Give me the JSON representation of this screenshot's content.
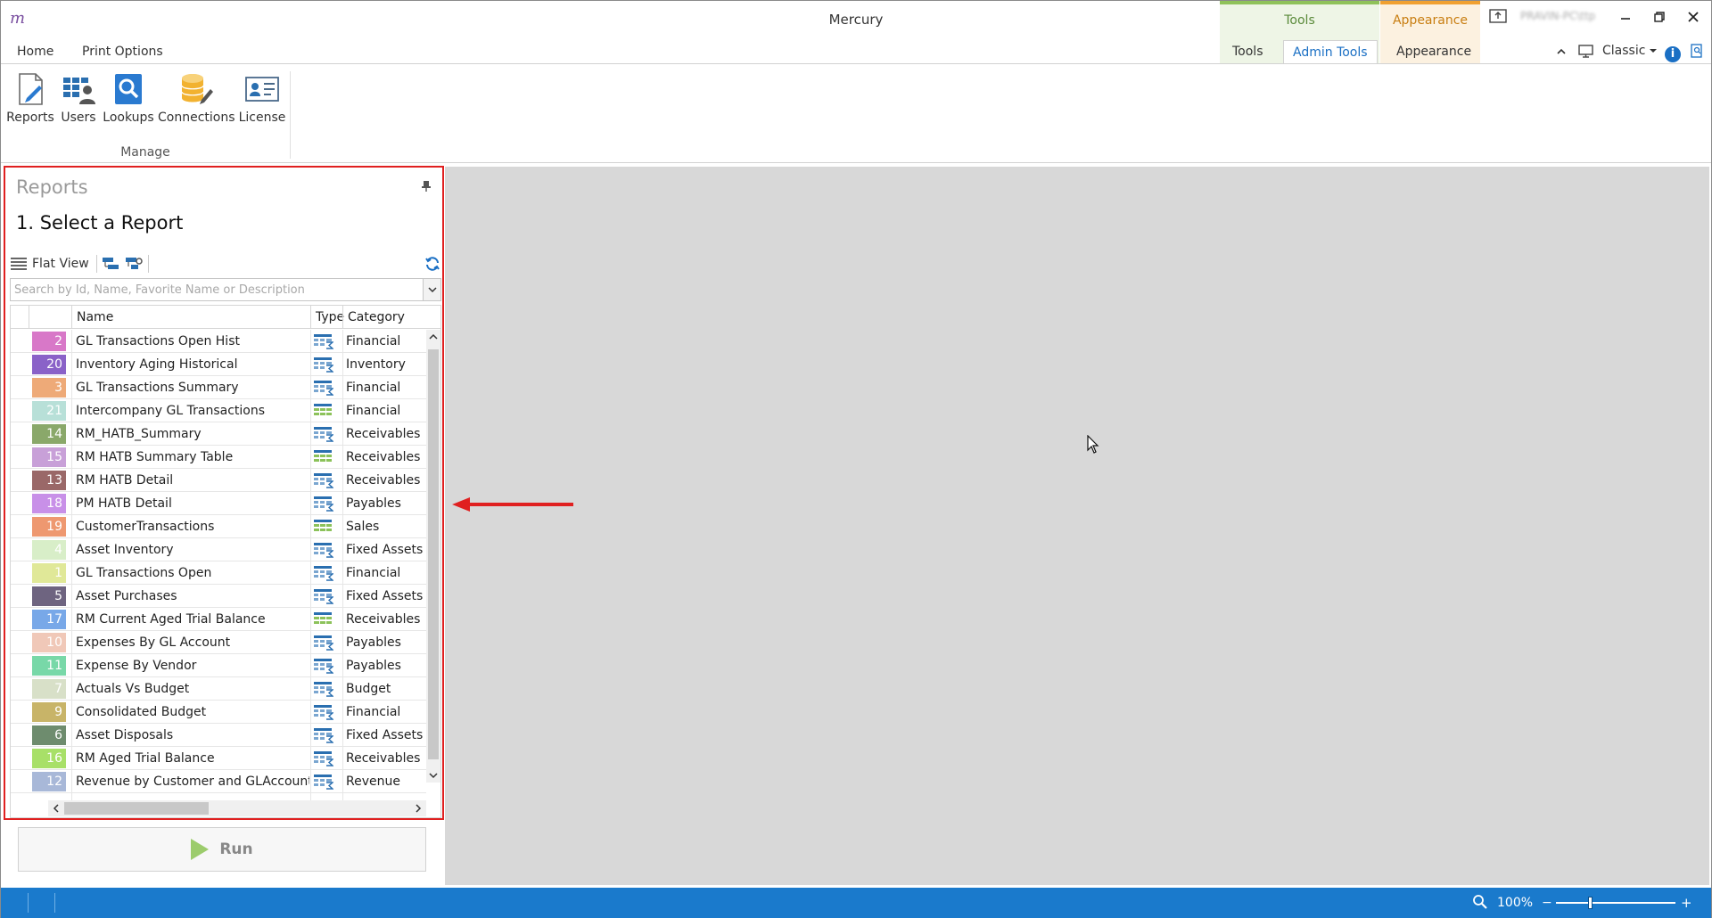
{
  "window": {
    "title": "Mercury",
    "blurred_user": "PRAVIN-PC\\ttp"
  },
  "context_groups": {
    "tools": "Tools",
    "appearance": "Appearance"
  },
  "ribbon": {
    "tabs": {
      "home": "Home",
      "print_options": "Print Options",
      "tools": "Tools",
      "admin_tools": "Admin Tools",
      "appearance": "Appearance"
    },
    "theme": "Classic",
    "buttons": {
      "reports": "Reports",
      "users": "Users",
      "lookups": "Lookups",
      "connections": "Connections",
      "license": "License"
    },
    "group": "Manage"
  },
  "panel": {
    "title": "Reports",
    "heading": "1. Select a Report",
    "flat_view": "Flat View",
    "search_placeholder": "Search by Id, Name, Favorite Name or Description",
    "columns": {
      "name": "Name",
      "type": "Type",
      "category": "Category"
    },
    "rows": [
      {
        "id": "2",
        "name": "GL Transactions Open Hist",
        "category": "Financial",
        "color": "#d878c8",
        "type_icon": "table-sum-icon"
      },
      {
        "id": "20",
        "name": "Inventory Aging Historical",
        "category": "Inventory",
        "color": "#8a62c8",
        "type_icon": "table-sum-icon"
      },
      {
        "id": "3",
        "name": "GL Transactions Summary",
        "category": "Financial",
        "color": "#eeaa78",
        "type_icon": "table-sum-icon"
      },
      {
        "id": "21",
        "name": "Intercompany GL Transactions",
        "category": "Financial",
        "color": "#b8e0d8",
        "type_icon": "table-icon"
      },
      {
        "id": "14",
        "name": "RM_HATB_Summary",
        "category": "Receivables",
        "color": "#8aa86a",
        "type_icon": "table-sum-icon"
      },
      {
        "id": "15",
        "name": "RM HATB Summary Table",
        "category": "Receivables",
        "color": "#c8a0d8",
        "type_icon": "table-icon"
      },
      {
        "id": "13",
        "name": "RM HATB Detail",
        "category": "Receivables",
        "color": "#9a6868",
        "type_icon": "table-sum-icon"
      },
      {
        "id": "18",
        "name": "PM HATB Detail",
        "category": "Payables",
        "color": "#c890e8",
        "type_icon": "table-sum-icon"
      },
      {
        "id": "19",
        "name": "CustomerTransactions",
        "category": "Sales",
        "color": "#ee9870",
        "type_icon": "table-icon"
      },
      {
        "id": "4",
        "name": "Asset Inventory",
        "category": "Fixed Assets",
        "color": "#d8eec8",
        "type_icon": "table-sum-icon"
      },
      {
        "id": "1",
        "name": "GL Transactions Open",
        "category": "Financial",
        "color": "#e0e898",
        "type_icon": "table-sum-icon"
      },
      {
        "id": "5",
        "name": "Asset Purchases",
        "category": "Fixed Assets",
        "color": "#6e6480",
        "type_icon": "table-sum-icon"
      },
      {
        "id": "17",
        "name": "RM Current Aged Trial Balance",
        "category": "Receivables",
        "color": "#78a8e8",
        "type_icon": "table-icon"
      },
      {
        "id": "10",
        "name": "Expenses By GL Account",
        "category": "Payables",
        "color": "#f0c8b8",
        "type_icon": "table-sum-icon"
      },
      {
        "id": "11",
        "name": "Expense By Vendor",
        "category": "Payables",
        "color": "#78d8a8",
        "type_icon": "table-sum-icon"
      },
      {
        "id": "7",
        "name": "Actuals Vs Budget",
        "category": "Budget",
        "color": "#d8e0c8",
        "type_icon": "table-sum-icon"
      },
      {
        "id": "9",
        "name": "Consolidated Budget",
        "category": "Financial",
        "color": "#c8b468",
        "type_icon": "table-sum-icon"
      },
      {
        "id": "6",
        "name": "Asset Disposals",
        "category": "Fixed Assets",
        "color": "#6e8c6e",
        "type_icon": "table-sum-icon"
      },
      {
        "id": "16",
        "name": "RM Aged Trial Balance",
        "category": "Receivables",
        "color": "#a8e068",
        "type_icon": "table-sum-icon"
      },
      {
        "id": "12",
        "name": "Revenue by Customer and GLAccount",
        "category": "Revenue",
        "color": "#a8b8d8",
        "type_icon": "table-sum-icon"
      }
    ],
    "run_label": "Run"
  },
  "status": {
    "zoom": "100%"
  },
  "colors": {
    "accent": "#1a6fc4",
    "status_bar": "#1a7acc",
    "annotation": "#e02020",
    "workspace": "#d8d8d8"
  }
}
